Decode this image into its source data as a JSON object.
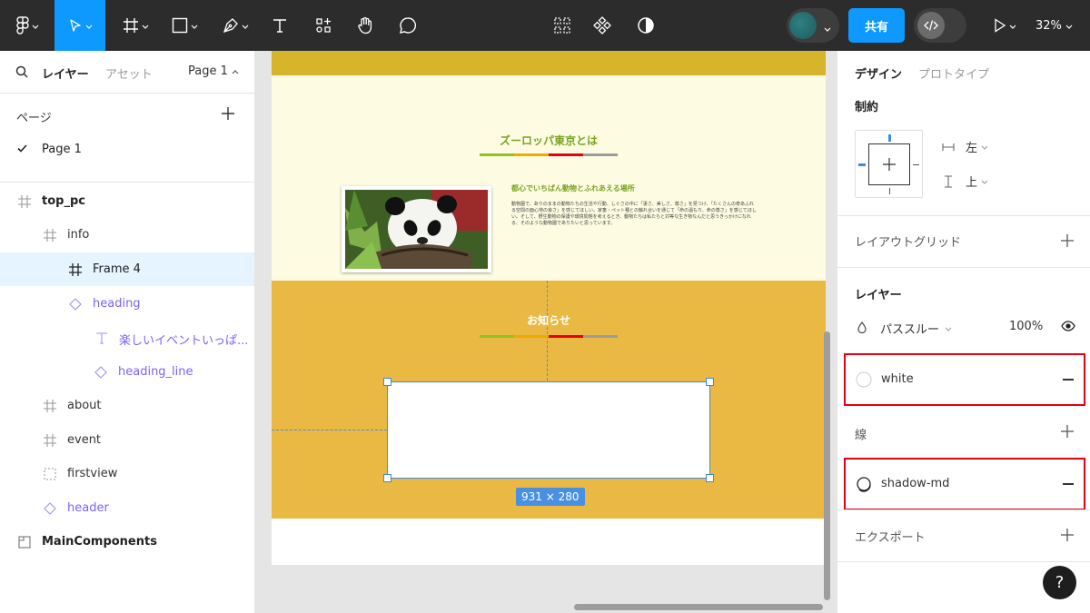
{
  "toolbar": {
    "tools": [
      {
        "name": "main-menu",
        "icon": "figma-logo-icon"
      },
      {
        "name": "move-tool",
        "icon": "cursor-arrow-icon",
        "active": true
      },
      {
        "name": "frame-tool",
        "icon": "frame-hash-icon"
      },
      {
        "name": "shape-tool",
        "icon": "rectangle-icon"
      },
      {
        "name": "pen-tool",
        "icon": "pen-nib-icon"
      },
      {
        "name": "text-tool",
        "icon": "text-t-icon"
      },
      {
        "name": "resources-tool",
        "icon": "shapes-plus-icon"
      },
      {
        "name": "hand-tool",
        "icon": "hand-icon"
      },
      {
        "name": "comment-tool",
        "icon": "speech-bubble-icon"
      }
    ],
    "center_tools": [
      "component-grid-icon",
      "component-diamond-icon",
      "contrast-half-icon"
    ],
    "share_label": "共有",
    "zoom": "32%",
    "accent": "#0d99ff"
  },
  "left_panel": {
    "tabs": {
      "layers": "レイヤー",
      "assets": "アセット"
    },
    "page_selector": "Page 1",
    "pages_heading": "ページ",
    "pages": [
      {
        "label": "Page 1",
        "current": true
      }
    ],
    "layers": [
      {
        "label": "top_pc",
        "type": "frame",
        "indent": 0,
        "bold": true
      },
      {
        "label": "info",
        "type": "frame",
        "indent": 1
      },
      {
        "label": "Frame 4",
        "type": "frame",
        "indent": 2,
        "selected": true
      },
      {
        "label": "heading",
        "type": "component-instance",
        "indent": 2
      },
      {
        "label": "楽しいイベントいっぱ...",
        "type": "text",
        "indent": 3
      },
      {
        "label": "heading_line",
        "type": "component-instance",
        "indent": 3
      },
      {
        "label": "about",
        "type": "frame",
        "indent": 1
      },
      {
        "label": "event",
        "type": "frame",
        "indent": 1
      },
      {
        "label": "firstview",
        "type": "section-dashed",
        "indent": 1
      },
      {
        "label": "header",
        "type": "component-instance",
        "indent": 1
      },
      {
        "label": "MainComponents",
        "type": "page-frame",
        "indent": 0,
        "bold": true
      }
    ]
  },
  "canvas": {
    "about_title": "ズーロッパ東京とは",
    "about_subtitle": "都心でいちばん動物とふれあえる場所",
    "about_body": "動物園で、ありのままの動物たちの生活や行動、しぐさの中に「凄さ、美しさ、尊さ」を見つけ、「たくさんの奇あふれる空間の面心地の良さ」を感じてほしい。家畜・ペット種との触れ合いを通じて「命の温もり、命の尊さ」を感じてほしい。そして、野生動物の保護や環境問題を考えるとき、動物たちは私たちと対等な生き物なんだと思うきっかけになれる、そのような動物園でありたいと思っています。",
    "news_title": "お知らせ",
    "selection_size": "931 × 280",
    "heading_line_colors": [
      "#8fc31f",
      "#f2a900",
      "#e60012",
      "#9c9c9c"
    ],
    "colors": {
      "top_band": "#d6b42c",
      "about_bg": "#fdfce2",
      "news_bg": "#e9b943",
      "accent_green": "#7aa323",
      "selection": "#3c8be0"
    }
  },
  "right_panel": {
    "tabs": {
      "design": "デザイン",
      "prototype": "プロトタイプ"
    },
    "constraints_heading": "制約",
    "horizontal_constraint": "左",
    "vertical_constraint": "上",
    "layout_grid_heading": "レイアウトグリッド",
    "layer_heading": "レイヤー",
    "blend_mode": "パススルー",
    "opacity": "100%",
    "fill_style": "white",
    "stroke_heading": "線",
    "effect_style": "shadow-md",
    "export_heading": "エクスポート",
    "help": "?",
    "highlight_color": "#e60012"
  }
}
